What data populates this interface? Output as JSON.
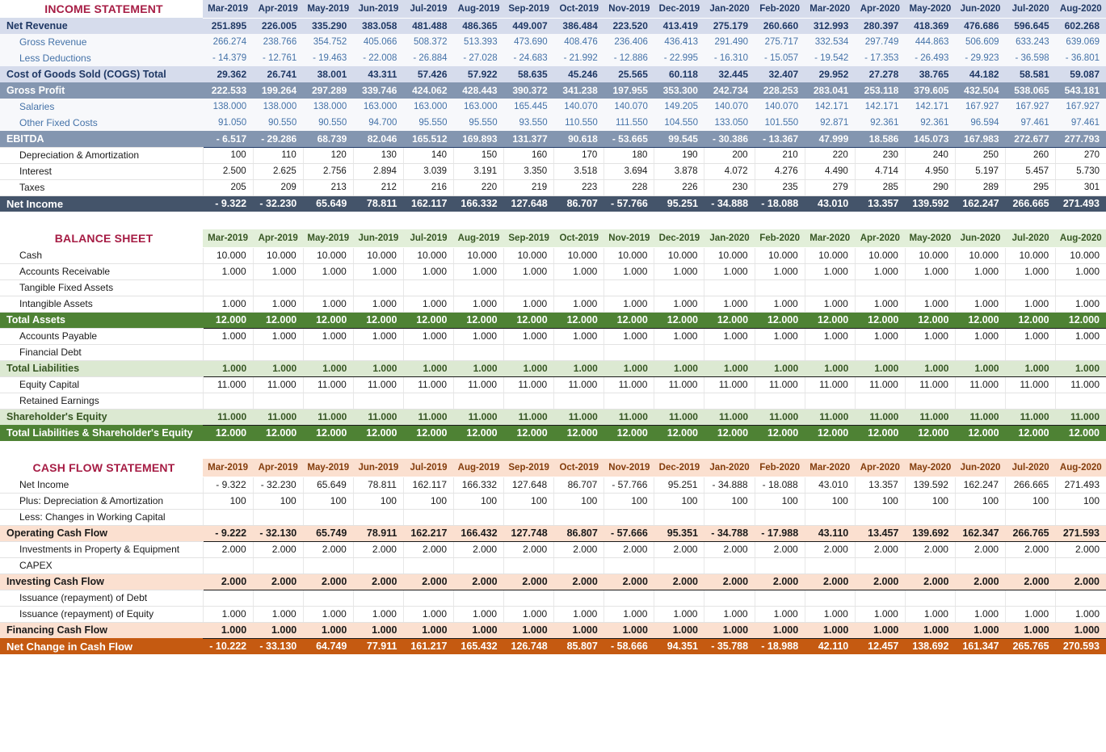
{
  "colors": {
    "section_title": "#A61C44",
    "is_header_bg": "#D6DCEC",
    "is_header_fg": "#1F3864",
    "is_slate_bg": "#8496B0",
    "is_dark_bg": "#44546A",
    "bs_header_bg": "#E2EFD9",
    "bs_light_green": "#DCE9D2",
    "bs_dark_green": "#4E8234",
    "cf_header_bg": "#FBE0D0",
    "cf_orange": "#C55A11"
  },
  "periods": [
    "Mar-2019",
    "Apr-2019",
    "May-2019",
    "Jun-2019",
    "Jul-2019",
    "Aug-2019",
    "Sep-2019",
    "Oct-2019",
    "Nov-2019",
    "Dec-2019",
    "Jan-2020",
    "Feb-2020",
    "Mar-2020",
    "Apr-2020",
    "May-2020",
    "Jun-2020",
    "Jul-2020",
    "Aug-2020"
  ],
  "income_statement": {
    "title": "INCOME STATEMENT",
    "rows": [
      {
        "label": "Net Revenue",
        "style": "bluelight",
        "indent": 0,
        "values": [
          "251.895",
          "226.005",
          "335.290",
          "383.058",
          "481.488",
          "486.365",
          "449.007",
          "386.484",
          "223.520",
          "413.419",
          "275.179",
          "260.660",
          "312.993",
          "280.397",
          "418.369",
          "476.686",
          "596.645",
          "602.268"
        ]
      },
      {
        "label": "Gross Revenue",
        "style": "sub",
        "indent": 1,
        "values": [
          "266.274",
          "238.766",
          "354.752",
          "405.066",
          "508.372",
          "513.393",
          "473.690",
          "408.476",
          "236.406",
          "436.413",
          "291.490",
          "275.717",
          "332.534",
          "297.749",
          "444.863",
          "506.609",
          "633.243",
          "639.069"
        ]
      },
      {
        "label": "Less Deductions",
        "style": "sub",
        "indent": 1,
        "values": [
          "- 14.379",
          "- 12.761",
          "- 19.463",
          "- 22.008",
          "- 26.884",
          "- 27.028",
          "- 24.683",
          "- 21.992",
          "- 12.886",
          "- 22.995",
          "- 16.310",
          "- 15.057",
          "- 19.542",
          "- 17.353",
          "- 26.493",
          "- 29.923",
          "- 36.598",
          "- 36.801"
        ]
      },
      {
        "label": "Cost of Goods Sold (COGS) Total",
        "style": "bluelight",
        "indent": 0,
        "values": [
          "29.362",
          "26.741",
          "38.001",
          "43.311",
          "57.426",
          "57.922",
          "58.635",
          "45.246",
          "25.565",
          "60.118",
          "32.445",
          "32.407",
          "29.952",
          "27.278",
          "38.765",
          "44.182",
          "58.581",
          "59.087"
        ]
      },
      {
        "label": "Gross Profit",
        "style": "slate",
        "indent": 0,
        "values": [
          "222.533",
          "199.264",
          "297.289",
          "339.746",
          "424.062",
          "428.443",
          "390.372",
          "341.238",
          "197.955",
          "353.300",
          "242.734",
          "228.253",
          "283.041",
          "253.118",
          "379.605",
          "432.504",
          "538.065",
          "543.181"
        ]
      },
      {
        "label": "Salaries",
        "style": "sub",
        "indent": 1,
        "values": [
          "138.000",
          "138.000",
          "138.000",
          "163.000",
          "163.000",
          "163.000",
          "165.445",
          "140.070",
          "140.070",
          "149.205",
          "140.070",
          "140.070",
          "142.171",
          "142.171",
          "142.171",
          "167.927",
          "167.927",
          "167.927"
        ]
      },
      {
        "label": "Other Fixed Costs",
        "style": "sub",
        "indent": 1,
        "values": [
          "91.050",
          "90.550",
          "90.550",
          "94.700",
          "95.550",
          "95.550",
          "93.550",
          "110.550",
          "111.550",
          "104.550",
          "133.050",
          "101.550",
          "92.871",
          "92.361",
          "92.361",
          "96.594",
          "97.461",
          "97.461"
        ]
      },
      {
        "label": "EBITDA",
        "style": "slate",
        "indent": 0,
        "values": [
          "- 6.517",
          "- 29.286",
          "68.739",
          "82.046",
          "165.512",
          "169.893",
          "131.377",
          "90.618",
          "- 53.665",
          "99.545",
          "- 30.386",
          "- 13.367",
          "47.999",
          "18.586",
          "145.073",
          "167.983",
          "272.677",
          "277.793"
        ]
      },
      {
        "label": "Depreciation & Amortization",
        "style": "white",
        "indent": 1,
        "values": [
          "100",
          "110",
          "120",
          "130",
          "140",
          "150",
          "160",
          "170",
          "180",
          "190",
          "200",
          "210",
          "220",
          "230",
          "240",
          "250",
          "260",
          "270"
        ]
      },
      {
        "label": "Interest",
        "style": "white",
        "indent": 1,
        "values": [
          "2.500",
          "2.625",
          "2.756",
          "2.894",
          "3.039",
          "3.191",
          "3.350",
          "3.518",
          "3.694",
          "3.878",
          "4.072",
          "4.276",
          "4.490",
          "4.714",
          "4.950",
          "5.197",
          "5.457",
          "5.730"
        ]
      },
      {
        "label": "Taxes",
        "style": "white",
        "indent": 1,
        "values": [
          "205",
          "209",
          "213",
          "212",
          "216",
          "220",
          "219",
          "223",
          "228",
          "226",
          "230",
          "235",
          "279",
          "285",
          "290",
          "289",
          "295",
          "301"
        ]
      },
      {
        "label": "Net Income",
        "style": "dark",
        "indent": 0,
        "values": [
          "- 9.322",
          "- 32.230",
          "65.649",
          "78.811",
          "162.117",
          "166.332",
          "127.648",
          "86.707",
          "- 57.766",
          "95.251",
          "- 34.888",
          "- 18.088",
          "43.010",
          "13.357",
          "139.592",
          "162.247",
          "266.665",
          "271.493"
        ]
      }
    ]
  },
  "balance_sheet": {
    "title": "BALANCE SHEET",
    "rows": [
      {
        "label": "Cash",
        "style": "plain",
        "indent": 1,
        "values": [
          "10.000",
          "10.000",
          "10.000",
          "10.000",
          "10.000",
          "10.000",
          "10.000",
          "10.000",
          "10.000",
          "10.000",
          "10.000",
          "10.000",
          "10.000",
          "10.000",
          "10.000",
          "10.000",
          "10.000",
          "10.000"
        ]
      },
      {
        "label": "Accounts Receivable",
        "style": "plain",
        "indent": 1,
        "values": [
          "1.000",
          "1.000",
          "1.000",
          "1.000",
          "1.000",
          "1.000",
          "1.000",
          "1.000",
          "1.000",
          "1.000",
          "1.000",
          "1.000",
          "1.000",
          "1.000",
          "1.000",
          "1.000",
          "1.000",
          "1.000"
        ]
      },
      {
        "label": "Tangible Fixed Assets",
        "style": "plain",
        "indent": 1,
        "values": [
          "",
          "",
          "",
          "",
          "",
          "",
          "",
          "",
          "",
          "",
          "",
          "",
          "",
          "",
          "",
          "",
          "",
          ""
        ]
      },
      {
        "label": "Intangible Assets",
        "style": "plain",
        "indent": 1,
        "values": [
          "1.000",
          "1.000",
          "1.000",
          "1.000",
          "1.000",
          "1.000",
          "1.000",
          "1.000",
          "1.000",
          "1.000",
          "1.000",
          "1.000",
          "1.000",
          "1.000",
          "1.000",
          "1.000",
          "1.000",
          "1.000"
        ]
      },
      {
        "label": "Total Assets",
        "style": "darkgreen",
        "indent": 0,
        "values": [
          "12.000",
          "12.000",
          "12.000",
          "12.000",
          "12.000",
          "12.000",
          "12.000",
          "12.000",
          "12.000",
          "12.000",
          "12.000",
          "12.000",
          "12.000",
          "12.000",
          "12.000",
          "12.000",
          "12.000",
          "12.000"
        ]
      },
      {
        "label": "Accounts Payable",
        "style": "plain",
        "indent": 1,
        "values": [
          "1.000",
          "1.000",
          "1.000",
          "1.000",
          "1.000",
          "1.000",
          "1.000",
          "1.000",
          "1.000",
          "1.000",
          "1.000",
          "1.000",
          "1.000",
          "1.000",
          "1.000",
          "1.000",
          "1.000",
          "1.000"
        ]
      },
      {
        "label": "Financial Debt",
        "style": "plain",
        "indent": 1,
        "values": [
          "",
          "",
          "",
          "",
          "",
          "",
          "",
          "",
          "",
          "",
          "",
          "",
          "",
          "",
          "",
          "",
          "",
          ""
        ]
      },
      {
        "label": "Total Liabilities",
        "style": "lightgreen",
        "indent": 0,
        "values": [
          "1.000",
          "1.000",
          "1.000",
          "1.000",
          "1.000",
          "1.000",
          "1.000",
          "1.000",
          "1.000",
          "1.000",
          "1.000",
          "1.000",
          "1.000",
          "1.000",
          "1.000",
          "1.000",
          "1.000",
          "1.000"
        ]
      },
      {
        "label": "Equity Capital",
        "style": "plain",
        "indent": 1,
        "values": [
          "11.000",
          "11.000",
          "11.000",
          "11.000",
          "11.000",
          "11.000",
          "11.000",
          "11.000",
          "11.000",
          "11.000",
          "11.000",
          "11.000",
          "11.000",
          "11.000",
          "11.000",
          "11.000",
          "11.000",
          "11.000"
        ]
      },
      {
        "label": "Retained Earnings",
        "style": "plain",
        "indent": 1,
        "values": [
          "",
          "",
          "",
          "",
          "",
          "",
          "",
          "",
          "",
          "",
          "",
          "",
          "",
          "",
          "",
          "",
          "",
          ""
        ]
      },
      {
        "label": "Shareholder's Equity",
        "style": "lightgreen",
        "indent": 0,
        "values": [
          "11.000",
          "11.000",
          "11.000",
          "11.000",
          "11.000",
          "11.000",
          "11.000",
          "11.000",
          "11.000",
          "11.000",
          "11.000",
          "11.000",
          "11.000",
          "11.000",
          "11.000",
          "11.000",
          "11.000",
          "11.000"
        ]
      },
      {
        "label": "Total Liabilities & Shareholder's Equity",
        "style": "darkgreen",
        "indent": 0,
        "values": [
          "12.000",
          "12.000",
          "12.000",
          "12.000",
          "12.000",
          "12.000",
          "12.000",
          "12.000",
          "12.000",
          "12.000",
          "12.000",
          "12.000",
          "12.000",
          "12.000",
          "12.000",
          "12.000",
          "12.000",
          "12.000"
        ]
      }
    ]
  },
  "cash_flow_statement": {
    "title": "CASH FLOW STATEMENT",
    "rows": [
      {
        "label": "Net Income",
        "style": "plain",
        "indent": 1,
        "values": [
          "- 9.322",
          "- 32.230",
          "65.649",
          "78.811",
          "162.117",
          "166.332",
          "127.648",
          "86.707",
          "- 57.766",
          "95.251",
          "- 34.888",
          "- 18.088",
          "43.010",
          "13.357",
          "139.592",
          "162.247",
          "266.665",
          "271.493"
        ]
      },
      {
        "label": "Plus: Depreciation & Amortization",
        "style": "plain",
        "indent": 1,
        "values": [
          "100",
          "100",
          "100",
          "100",
          "100",
          "100",
          "100",
          "100",
          "100",
          "100",
          "100",
          "100",
          "100",
          "100",
          "100",
          "100",
          "100",
          "100"
        ]
      },
      {
        "label": "Less: Changes in Working Capital",
        "style": "plain",
        "indent": 1,
        "values": [
          "",
          "",
          "",
          "",
          "",
          "",
          "",
          "",
          "",
          "",
          "",
          "",
          "",
          "",
          "",
          "",
          "",
          ""
        ]
      },
      {
        "label": "Operating Cash Flow",
        "style": "peach",
        "indent": 0,
        "values": [
          "- 9.222",
          "- 32.130",
          "65.749",
          "78.911",
          "162.217",
          "166.432",
          "127.748",
          "86.807",
          "- 57.666",
          "95.351",
          "- 34.788",
          "- 17.988",
          "43.110",
          "13.457",
          "139.692",
          "162.347",
          "266.765",
          "271.593"
        ]
      },
      {
        "label": "Investments in Property & Equipment",
        "style": "plain",
        "indent": 1,
        "values": [
          "2.000",
          "2.000",
          "2.000",
          "2.000",
          "2.000",
          "2.000",
          "2.000",
          "2.000",
          "2.000",
          "2.000",
          "2.000",
          "2.000",
          "2.000",
          "2.000",
          "2.000",
          "2.000",
          "2.000",
          "2.000"
        ]
      },
      {
        "label": "CAPEX",
        "style": "plain",
        "indent": 1,
        "values": [
          "",
          "",
          "",
          "",
          "",
          "",
          "",
          "",
          "",
          "",
          "",
          "",
          "",
          "",
          "",
          "",
          "",
          ""
        ]
      },
      {
        "label": "Investing Cash Flow",
        "style": "peach",
        "indent": 0,
        "values": [
          "2.000",
          "2.000",
          "2.000",
          "2.000",
          "2.000",
          "2.000",
          "2.000",
          "2.000",
          "2.000",
          "2.000",
          "2.000",
          "2.000",
          "2.000",
          "2.000",
          "2.000",
          "2.000",
          "2.000",
          "2.000"
        ]
      },
      {
        "label": "Issuance (repayment) of Debt",
        "style": "plain",
        "indent": 1,
        "values": [
          "",
          "",
          "",
          "",
          "",
          "",
          "",
          "",
          "",
          "",
          "",
          "",
          "",
          "",
          "",
          "",
          "",
          ""
        ]
      },
      {
        "label": "Issuance (repayment) of Equity",
        "style": "plain",
        "indent": 1,
        "values": [
          "1.000",
          "1.000",
          "1.000",
          "1.000",
          "1.000",
          "1.000",
          "1.000",
          "1.000",
          "1.000",
          "1.000",
          "1.000",
          "1.000",
          "1.000",
          "1.000",
          "1.000",
          "1.000",
          "1.000",
          "1.000"
        ]
      },
      {
        "label": "Financing Cash Flow",
        "style": "peach",
        "indent": 0,
        "values": [
          "1.000",
          "1.000",
          "1.000",
          "1.000",
          "1.000",
          "1.000",
          "1.000",
          "1.000",
          "1.000",
          "1.000",
          "1.000",
          "1.000",
          "1.000",
          "1.000",
          "1.000",
          "1.000",
          "1.000",
          "1.000"
        ]
      },
      {
        "label": "Net Change in Cash Flow",
        "style": "orange",
        "indent": 0,
        "values": [
          "- 10.222",
          "- 33.130",
          "64.749",
          "77.911",
          "161.217",
          "165.432",
          "126.748",
          "85.807",
          "- 58.666",
          "94.351",
          "- 35.788",
          "- 18.988",
          "42.110",
          "12.457",
          "138.692",
          "161.347",
          "265.765",
          "270.593"
        ]
      }
    ]
  }
}
